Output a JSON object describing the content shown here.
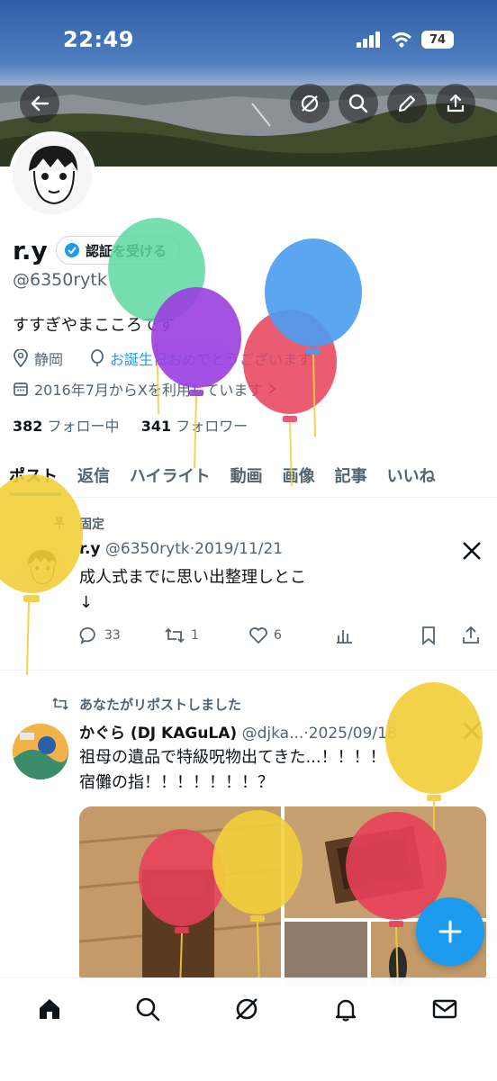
{
  "status_bar": {
    "time": "22:49",
    "battery": "74"
  },
  "profile": {
    "name": "r.y",
    "verify_label": "認証を受ける",
    "handle": "@6350rytk",
    "bio": "すすぎやまこころです",
    "location": "静岡",
    "birthday": "お誕生日おめでとうございます。",
    "joined": "2016年7月からXを利用しています",
    "following_count": "382",
    "following_label": "フォロー中",
    "followers_count": "341",
    "followers_label": "フォロワー"
  },
  "tabs": [
    "ポスト",
    "返信",
    "ハイライト",
    "動画",
    "画像",
    "記事",
    "いいね"
  ],
  "pinned_post": {
    "pin_label": "固定",
    "name": "r.y",
    "handle": "@6350rytk",
    "date": "2019/11/21",
    "text_line1": "成人式までに思い出整理しとこ",
    "text_line2": "↓",
    "replies": "33",
    "reposts": "1",
    "likes": "6"
  },
  "repost": {
    "label": "あなたがリポストしました",
    "name": "かぐら (DJ KAGuLA)",
    "handle": "@djka...",
    "date": "2025/09/18",
    "text_line1": "祖母の遺品で特級呪物出てきた...！！！！",
    "text_line2": "宿儺の指！！！！！！！？"
  },
  "colors": {
    "accent": "#1d9bf0",
    "text": "#0f1419",
    "secondary": "#536471",
    "balloon_green": "#5fd9a0",
    "balloon_purple": "#9b3fe0",
    "balloon_blue": "#4a9cf0",
    "balloon_red": "#e8405a",
    "balloon_yellow": "#f2cf3a"
  },
  "icons": {
    "back": "arrow-left-icon",
    "grok": "grok-icon",
    "search": "search-icon",
    "edit": "pencil-icon",
    "share": "share-icon",
    "home": "home-icon",
    "notifications": "bell-icon",
    "messages": "envelope-icon"
  }
}
